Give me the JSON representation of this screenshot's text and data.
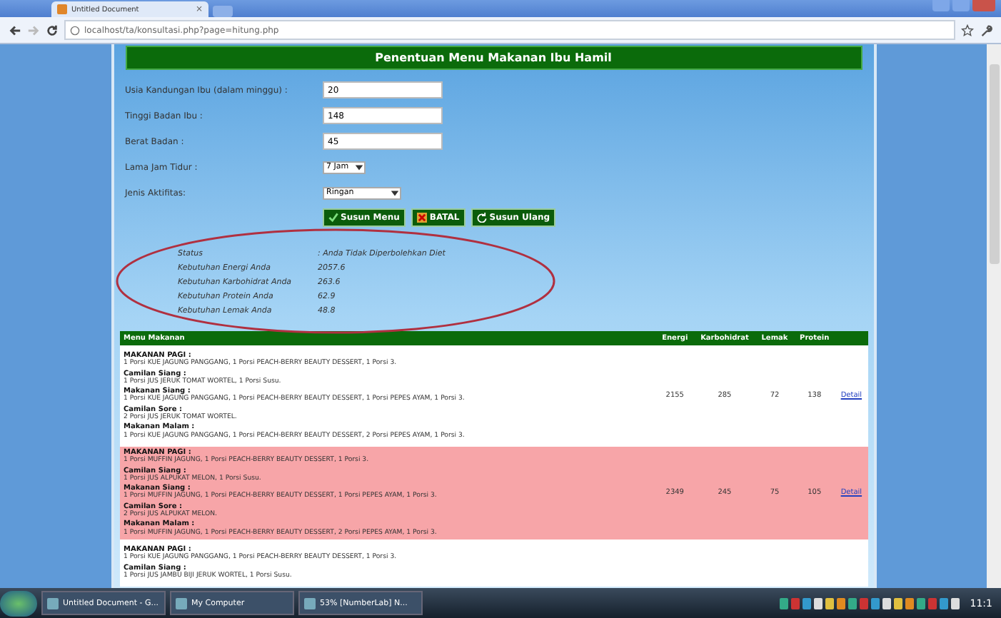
{
  "browser": {
    "tab_title": "Untitled Document",
    "tab_close": "×",
    "url": "localhost/ta/konsultasi.php?page=hitung.php"
  },
  "page_title": "Penentuan Menu Makanan Ibu Hamil",
  "form": {
    "fields": [
      {
        "kind": "input",
        "label": "Usia Kandungan Ibu (dalam minggu) :",
        "value": "20"
      },
      {
        "kind": "input",
        "label": "Tinggi Badan Ibu :",
        "value": "148"
      },
      {
        "kind": "input",
        "label": "Berat Badan :",
        "value": "45"
      },
      {
        "kind": "select",
        "label": "Lama Jam Tidur :",
        "value": "7 Jam"
      },
      {
        "kind": "select",
        "label": "Jenis Aktifitas:",
        "value": "Ringan"
      }
    ],
    "buttons": [
      {
        "kind": "ok",
        "label": "Susun Menu"
      },
      {
        "kind": "cancel",
        "label": "BATAL"
      },
      {
        "kind": "redo",
        "label": "Susun Ulang"
      }
    ]
  },
  "results": [
    {
      "label": "Status",
      "value": ": Anda Tidak Diperbolehkan Diet"
    },
    {
      "label": "Kebutuhan Energi Anda",
      "value": "2057.6"
    },
    {
      "label": "Kebutuhan Karbohidrat Anda",
      "value": "263.6"
    },
    {
      "label": "Kebutuhan Protein Anda",
      "value": "62.9"
    },
    {
      "label": "Kebutuhan Lemak Anda",
      "value": "48.8"
    }
  ],
  "table": {
    "columns": [
      "Menu Makanan",
      "Energi",
      "Karbohidrat",
      "Lemak",
      "Protein"
    ],
    "rows": [
      {
        "selected": false,
        "sections": [
          {
            "title": "MAKANAN PAGI :",
            "text": "1 Porsi KUE JAGUNG PANGGANG, 1 Porsi PEACH-BERRY BEAUTY DESSERT, 1 Porsi 3."
          },
          {
            "title": "Camilan Siang :",
            "text": "1 Porsi JUS JERUK TOMAT WORTEL, 1 Porsi Susu."
          },
          {
            "title": "Makanan Siang :",
            "text": "1 Porsi KUE JAGUNG PANGGANG, 1 Porsi PEACH-BERRY BEAUTY DESSERT, 1 Porsi PEPES AYAM, 1 Porsi 3."
          },
          {
            "title": "Camilan Sore :",
            "text": "2 Porsi JUS JERUK TOMAT WORTEL."
          },
          {
            "title": "Makanan Malam :",
            "text": "1 Porsi KUE JAGUNG PANGGANG, 1 Porsi PEACH-BERRY BEAUTY DESSERT, 2 Porsi PEPES AYAM, 1 Porsi 3."
          }
        ],
        "energi": "2155",
        "karbohidrat": "285",
        "lemak": "72",
        "protein": "138",
        "link": "Detail"
      },
      {
        "selected": true,
        "sections": [
          {
            "title": "MAKANAN PAGI :",
            "text": "1 Porsi MUFFIN JAGUNG, 1 Porsi PEACH-BERRY BEAUTY DESSERT, 1 Porsi 3."
          },
          {
            "title": "Camilan Siang :",
            "text": "1 Porsi JUS ALPUKAT MELON, 1 Porsi Susu."
          },
          {
            "title": "Makanan Siang :",
            "text": "1 Porsi MUFFIN JAGUNG, 1 Porsi PEACH-BERRY BEAUTY DESSERT, 1 Porsi PEPES AYAM, 1 Porsi 3."
          },
          {
            "title": "Camilan Sore :",
            "text": "2 Porsi JUS ALPUKAT MELON."
          },
          {
            "title": "Makanan Malam :",
            "text": "1 Porsi MUFFIN JAGUNG, 1 Porsi PEACH-BERRY BEAUTY DESSERT, 2 Porsi PEPES AYAM, 1 Porsi 3."
          }
        ],
        "energi": "2349",
        "karbohidrat": "245",
        "lemak": "75",
        "protein": "105",
        "link": "Detail"
      },
      {
        "selected": false,
        "sections": [
          {
            "title": "MAKANAN PAGI :",
            "text": "1 Porsi KUE JAGUNG PANGGANG, 1 Porsi PEACH-BERRY BEAUTY DESSERT, 1 Porsi 3."
          },
          {
            "title": "Camilan Siang :",
            "text": "1 Porsi JUS JAMBU BIJI JERUK WORTEL, 1 Porsi Susu."
          }
        ]
      }
    ]
  },
  "taskbar": {
    "items": [
      {
        "label": "Untitled Document - G..."
      },
      {
        "label": "My Computer"
      },
      {
        "label": "53% [NumberLab] N..."
      }
    ],
    "clock": "11:1"
  }
}
